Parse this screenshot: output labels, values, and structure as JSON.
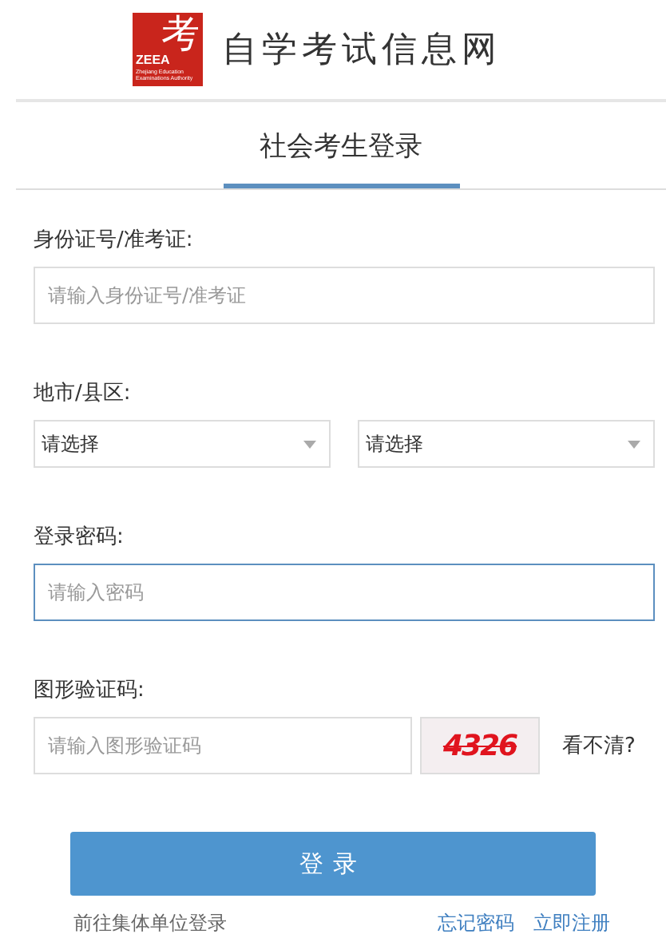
{
  "header": {
    "logo": {
      "glyph": "考",
      "abbr": "ZEEA",
      "subtitle": "Zhejiang Education Examinations Authority"
    },
    "site_title": "自学考试信息网"
  },
  "tabs": [
    {
      "label": "社会考生登录",
      "selected": true
    }
  ],
  "form": {
    "fields": [
      {
        "kind": "text",
        "label": "身份证号/准考证:",
        "placeholder": "请输入身份证号/准考证",
        "focused": false
      },
      {
        "kind": "selects",
        "label": "地市/县区:",
        "options": [
          "请选择",
          "请选择"
        ]
      },
      {
        "kind": "text",
        "label": "登录密码:",
        "placeholder": "请输入密码",
        "focused": true
      },
      {
        "kind": "captcha",
        "label": "图形验证码:",
        "placeholder": "请输入图形验证码",
        "captcha": "4326",
        "refresh": "看不清?"
      }
    ]
  },
  "login_button": "登录",
  "links": {
    "left": "前往集体单位登录",
    "right": [
      "忘记密码",
      "立即注册"
    ]
  }
}
